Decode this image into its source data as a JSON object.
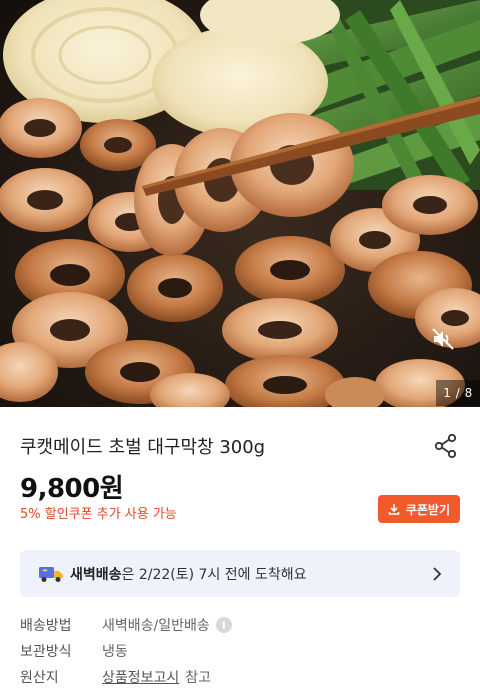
{
  "gallery": {
    "counter": "1 / 8",
    "mute_icon": "speaker-muted-icon"
  },
  "product": {
    "title": "쿠캣메이드 초벌 대구막창 300g",
    "price": "9,800원",
    "coupon_text": "5% 할인쿠폰 추가 사용 가능",
    "coupon_button": "쿠폰받기"
  },
  "delivery": {
    "highlight": "새벽배송",
    "rest": "은 2/22(토) 7시 전에 도착해요"
  },
  "info": [
    {
      "label": "배송방법",
      "value": "새벽배송/일반배송",
      "has_info_icon": true
    },
    {
      "label": "보관방식",
      "value": "냉동"
    },
    {
      "label": "원산지",
      "link": "상품정보고시",
      "suffix": " 참고"
    }
  ],
  "colors": {
    "accent": "#f25a2e",
    "coupon_text": "#e8462a",
    "delivery_bg": "#eff2fb"
  }
}
